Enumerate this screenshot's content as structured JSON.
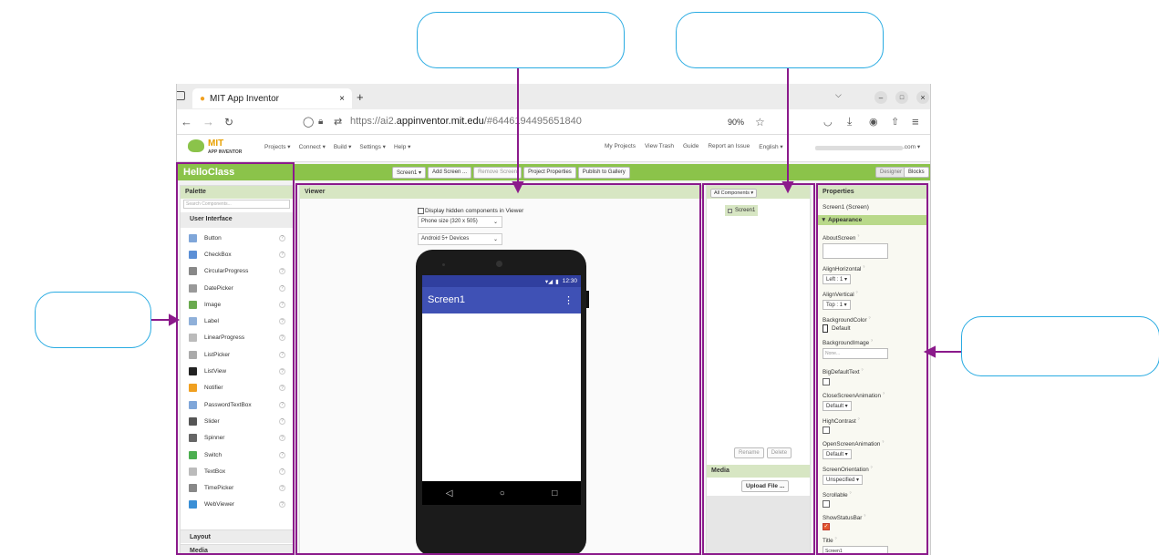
{
  "browser": {
    "tab_title": "MIT App Inventor",
    "url_prefix": "https://ai2.",
    "url_domain": "appinventor.mit.edu",
    "url_suffix": "/#6446194495651840",
    "zoom": "90%"
  },
  "app_menu": {
    "logo_top": "MIT",
    "logo_bottom": "APP INVENTOR",
    "menus": [
      "Projects ▾",
      "Connect ▾",
      "Build ▾",
      "Settings ▾",
      "Help ▾"
    ],
    "links": [
      "My Projects",
      "View Trash",
      "Guide",
      "Report an Issue",
      "English ▾"
    ],
    "account_suffix": ".com ▾"
  },
  "toolbar": {
    "project_name": "HelloClass",
    "screen_select": "Screen1 ▾",
    "add_screen": "Add Screen ...",
    "remove_screen": "Remove Screen",
    "project_properties": "Project Properties",
    "publish": "Publish to Gallery",
    "designer": "Designer",
    "blocks": "Blocks"
  },
  "palette": {
    "header": "Palette",
    "search_placeholder": "Search Components...",
    "category": "User Interface",
    "items": [
      {
        "label": "Button",
        "icon": "button-icon",
        "color": "#7fa6d9"
      },
      {
        "label": "CheckBox",
        "icon": "checkbox-icon",
        "color": "#5b8fd6"
      },
      {
        "label": "CircularProgress",
        "icon": "circular-progress-icon",
        "color": "#888888"
      },
      {
        "label": "DatePicker",
        "icon": "datepicker-icon",
        "color": "#999999"
      },
      {
        "label": "Image",
        "icon": "image-icon",
        "color": "#6aaa4f"
      },
      {
        "label": "Label",
        "icon": "label-icon",
        "color": "#8fb0d9"
      },
      {
        "label": "LinearProgress",
        "icon": "linear-progress-icon",
        "color": "#bbbbbb"
      },
      {
        "label": "ListPicker",
        "icon": "listpicker-icon",
        "color": "#aaaaaa"
      },
      {
        "label": "ListView",
        "icon": "listview-icon",
        "color": "#222222"
      },
      {
        "label": "Notifier",
        "icon": "notifier-icon",
        "color": "#f0a020"
      },
      {
        "label": "PasswordTextBox",
        "icon": "password-textbox-icon",
        "color": "#7fa6d9"
      },
      {
        "label": "Slider",
        "icon": "slider-icon",
        "color": "#555555"
      },
      {
        "label": "Spinner",
        "icon": "spinner-icon",
        "color": "#666666"
      },
      {
        "label": "Switch",
        "icon": "switch-icon",
        "color": "#4caf50"
      },
      {
        "label": "TextBox",
        "icon": "textbox-icon",
        "color": "#bbbbbb"
      },
      {
        "label": "TimePicker",
        "icon": "timepicker-icon",
        "color": "#888888"
      },
      {
        "label": "WebViewer",
        "icon": "webviewer-icon",
        "color": "#3a8fd6"
      }
    ],
    "layout": "Layout",
    "media": "Media"
  },
  "viewer": {
    "header": "Viewer",
    "display_hidden": "Display hidden components in Viewer",
    "phone_size": "Phone size (320 x 505)",
    "android": "Android 5+ Devices",
    "status_time": "12:30",
    "screen_title": "Screen1"
  },
  "components": {
    "dropdown": "All Components ▾",
    "tree_item": "Screen1",
    "rename": "Rename",
    "delete": "Delete",
    "media_header": "Media",
    "upload": "Upload File ..."
  },
  "properties": {
    "header": "Properties",
    "subtitle": "Screen1 (Screen)",
    "section": "▼ Appearance",
    "about": "AboutScreen",
    "align_h": "AlignHorizontal",
    "align_h_val": "Left : 1 ▾",
    "align_v": "AlignVertical",
    "align_v_val": "Top : 1 ▾",
    "bg_color": "BackgroundColor",
    "bg_color_val": "Default",
    "bg_image": "BackgroundImage",
    "bg_image_val": "None...",
    "big_text": "BigDefaultText",
    "close_anim": "CloseScreenAnimation",
    "close_anim_val": "Default ▾",
    "high_contrast": "HighContrast",
    "open_anim": "OpenScreenAnimation",
    "open_anim_val": "Default ▾",
    "orientation": "ScreenOrientation",
    "orientation_val": "Unspecified ▾",
    "scrollable": "Scrollable",
    "status_bar": "ShowStatusBar",
    "title": "Title",
    "title_val": "Screen1",
    "help_mark": "?"
  },
  "colors": {
    "accent_green": "#8bc34a",
    "highlight": "#8b1a8b",
    "callout": "#29abe2",
    "phone_blue": "#3f51b5"
  }
}
